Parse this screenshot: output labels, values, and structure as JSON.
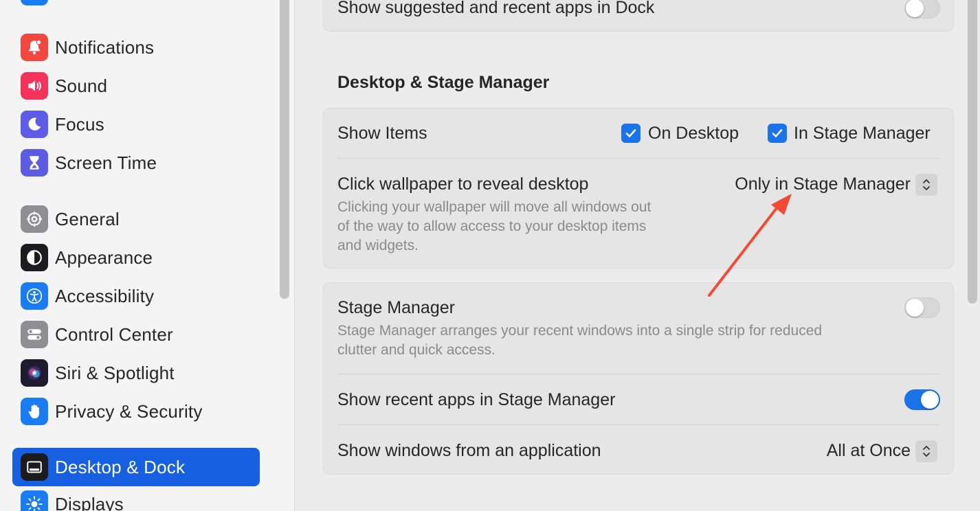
{
  "sidebar": {
    "items": [
      {
        "label": "Notifications",
        "icon": "bell-icon",
        "color": "#f2473f"
      },
      {
        "label": "Sound",
        "icon": "speaker-icon",
        "color": "#f4325a"
      },
      {
        "label": "Focus",
        "icon": "moon-icon",
        "color": "#5d5ce6"
      },
      {
        "label": "Screen Time",
        "icon": "hourglass-icon",
        "color": "#5e5be3"
      },
      {
        "label": "General",
        "icon": "gear-icon",
        "color": "#8e8e93"
      },
      {
        "label": "Appearance",
        "icon": "appearance-icon",
        "color": "#1c1c1e"
      },
      {
        "label": "Accessibility",
        "icon": "accessibility-icon",
        "color": "#1a7cf5"
      },
      {
        "label": "Control Center",
        "icon": "control-center-icon",
        "color": "#8e8e93"
      },
      {
        "label": "Siri & Spotlight",
        "icon": "siri-icon",
        "color": "#1c1c2e"
      },
      {
        "label": "Privacy & Security",
        "icon": "hand-icon",
        "color": "#1a7cf5"
      },
      {
        "label": "Desktop & Dock",
        "icon": "dock-icon",
        "color": "#1c1c1e"
      },
      {
        "label": "Displays",
        "icon": "sun-icon",
        "color": "#1a7cf5"
      }
    ],
    "selected": "Desktop & Dock"
  },
  "top_card": {
    "label": "Show suggested and recent apps in Dock",
    "toggle": false
  },
  "section": {
    "title": "Desktop & Stage Manager"
  },
  "card1": {
    "show_items_label": "Show Items",
    "on_desktop_label": "On Desktop",
    "on_desktop_checked": true,
    "in_stage_manager_label": "In Stage Manager",
    "in_stage_manager_checked": true,
    "click_wallpaper_label": "Click wallpaper to reveal desktop",
    "click_wallpaper_desc_1": "Clicking your wallpaper will move all windows out",
    "click_wallpaper_desc_2": "of the way to allow access to your desktop items",
    "click_wallpaper_desc_3": "and widgets.",
    "click_wallpaper_value": "Only in Stage Manager"
  },
  "card2": {
    "stage_manager_label": "Stage Manager",
    "stage_manager_toggle": false,
    "stage_manager_desc_1": "Stage Manager arranges your recent windows into a single strip for reduced",
    "stage_manager_desc_2": "clutter and quick access.",
    "recent_apps_label": "Show recent apps in Stage Manager",
    "recent_apps_toggle": true,
    "windows_from_app_label": "Show windows from an application",
    "windows_from_app_value": "All at Once"
  },
  "colors": {
    "accent": "#1a73e8",
    "selected_sidebar": "#1860e2",
    "annotation_arrow": "#f24a35"
  }
}
